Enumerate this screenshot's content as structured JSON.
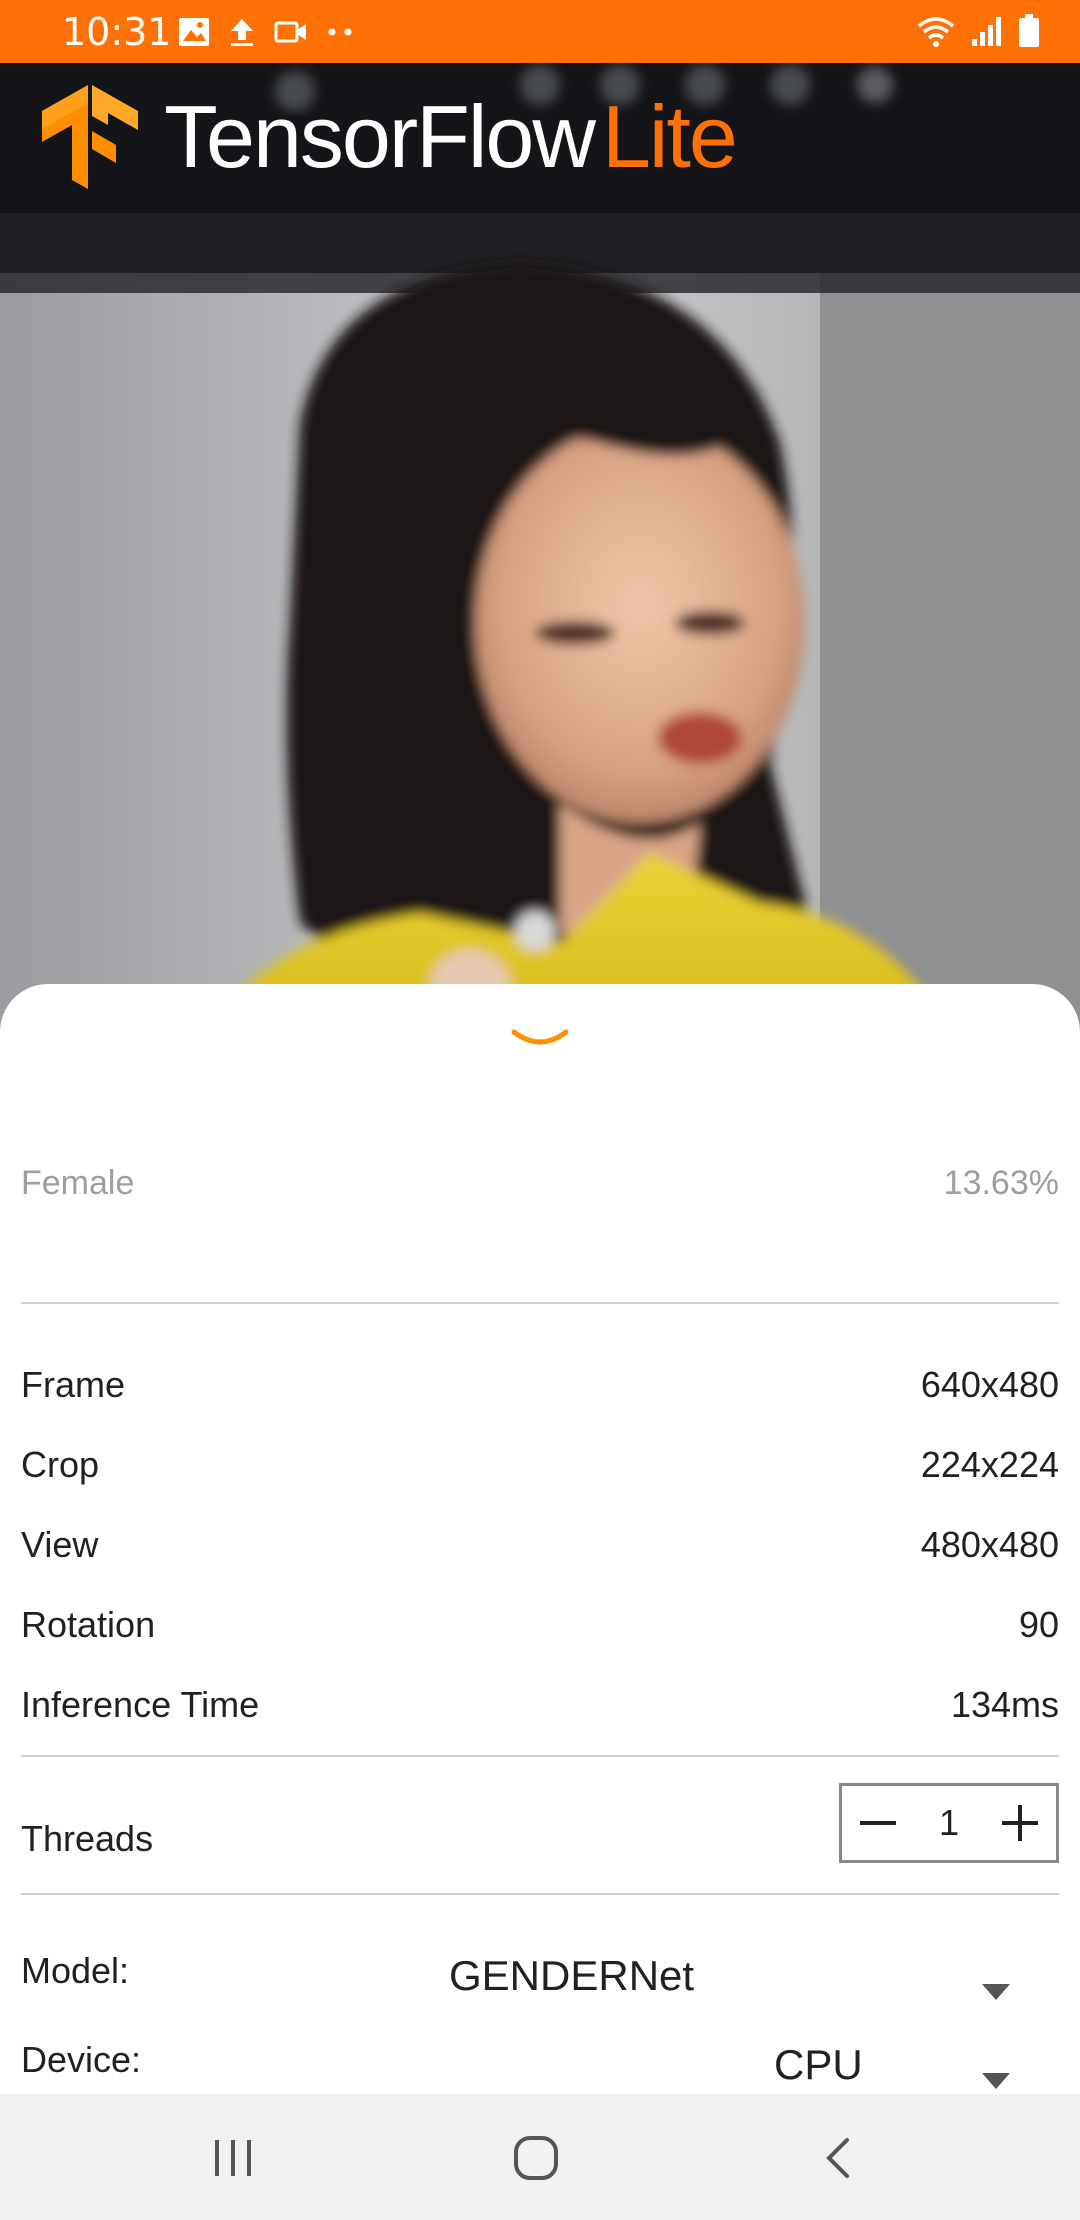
{
  "status_bar": {
    "time": "10:31",
    "left_icons": [
      "image-icon",
      "upload-icon",
      "video-icon",
      "more-dots-icon"
    ],
    "right_icons": [
      "wifi-icon",
      "signal-icon",
      "battery-icon"
    ]
  },
  "header": {
    "logo_name_main": "TensorFlow",
    "logo_name_accent": "Lite",
    "brand_color": "#FF7105"
  },
  "bottom_sheet": {
    "handle_icon": "chevron-down-icon",
    "result": {
      "label": "Female",
      "confidence": "13.63%"
    },
    "info_rows": [
      {
        "label": "Frame",
        "value": "640x480"
      },
      {
        "label": "Crop",
        "value": "224x224"
      },
      {
        "label": "View",
        "value": "480x480"
      },
      {
        "label": "Rotation",
        "value": "90"
      },
      {
        "label": "Inference Time",
        "value": "134ms"
      }
    ],
    "threads": {
      "label": "Threads",
      "value": "1"
    },
    "model": {
      "label": "Model:",
      "selected": "GENDERNet"
    },
    "device": {
      "label": "Device:",
      "selected": "CPU"
    }
  },
  "nav_bar": {
    "buttons": [
      "recent-apps-icon",
      "home-icon",
      "back-icon"
    ]
  }
}
